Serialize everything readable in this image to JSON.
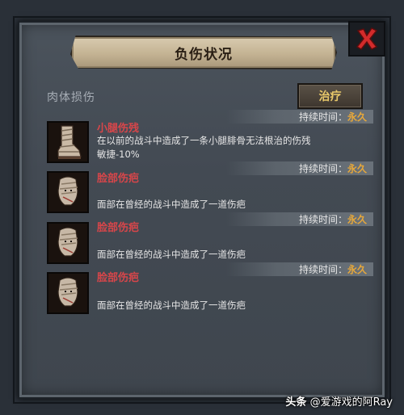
{
  "window": {
    "title": "负伤状况",
    "close_icon": "close-x-icon",
    "close_color": "#d32b2b"
  },
  "section": {
    "label": "肉体损伤",
    "heal_button": "治疗"
  },
  "duration_label": "持续时间：",
  "injuries": [
    {
      "icon": "bandaged-leg-icon",
      "name": "小腿伤残",
      "duration": "永久",
      "description": "在以前的战斗中造成了一条小腿腓骨无法根治的伤残",
      "stat": "敏捷-10%"
    },
    {
      "icon": "scarred-face-icon",
      "name": "脸部伤疤",
      "duration": "永久",
      "description": "面部在曾经的战斗中造成了一道伤疤",
      "stat": ""
    },
    {
      "icon": "scarred-face-icon",
      "name": "脸部伤疤",
      "duration": "永久",
      "description": "面部在曾经的战斗中造成了一道伤疤",
      "stat": ""
    },
    {
      "icon": "scarred-face-icon",
      "name": "脸部伤疤",
      "duration": "永久",
      "description": "面部在曾经的战斗中造成了一道伤疤",
      "stat": ""
    }
  ],
  "colors": {
    "injury_name": "#d8464a",
    "duration_value": "#e7a83a",
    "heal_text": "#e8c86a"
  },
  "watermark": {
    "prefix": "头条",
    "handle": "@爱游戏的阿Ray"
  }
}
